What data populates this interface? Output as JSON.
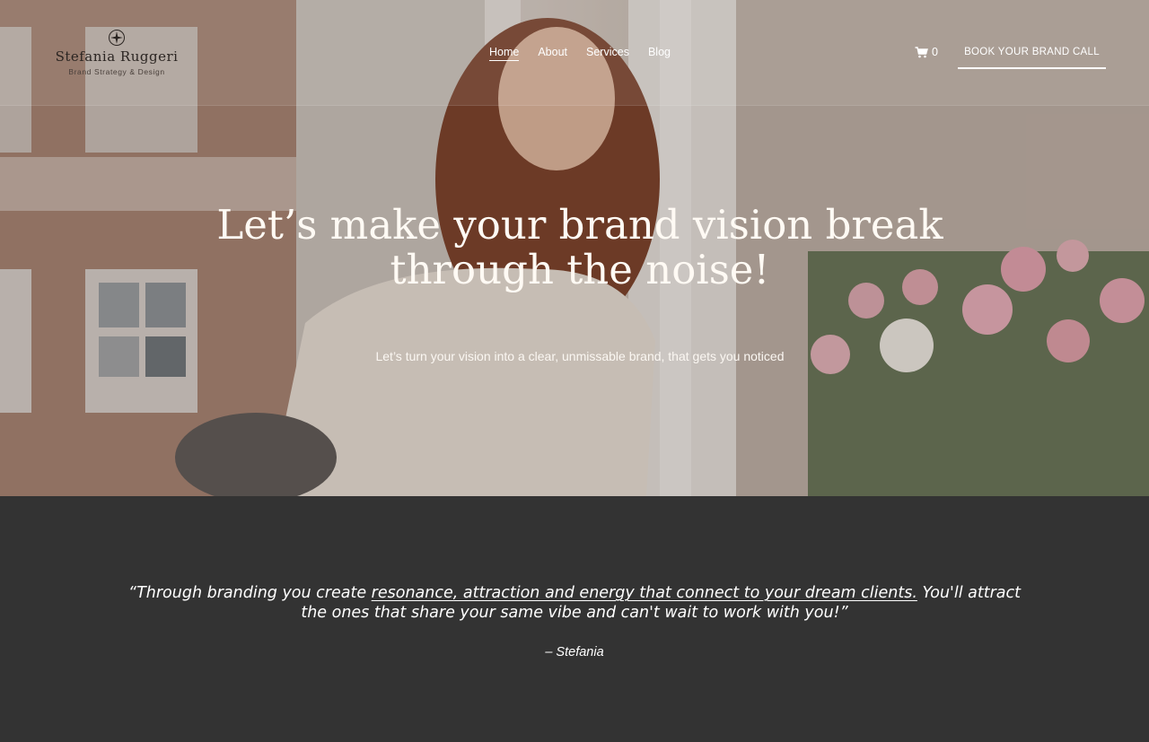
{
  "brand": {
    "name": "Stefania Ruggeri",
    "tagline": "Brand Strategy & Design",
    "logo_icon": "compass-rose-icon"
  },
  "nav": {
    "items": [
      {
        "label": "Home",
        "active": true
      },
      {
        "label": "About",
        "active": false
      },
      {
        "label": "Services",
        "active": false
      },
      {
        "label": "Blog",
        "active": false
      }
    ]
  },
  "cart": {
    "icon": "cart-icon",
    "count": "0"
  },
  "cta": {
    "label": "BOOK YOUR BRAND CALL"
  },
  "hero": {
    "title_line1": "Let’s make your brand vision break",
    "title_line2": "through the noise!",
    "subtitle": "Let’s turn your vision into a clear, unmissable brand, that gets you noticed"
  },
  "quote": {
    "before": "“Through branding you create ",
    "highlight": "resonance, attraction and energy that connect to your dream clients.",
    "after": " You'll attract the ones that share your same vibe and can't wait to work with you!”",
    "author": "– Stefania"
  },
  "colors": {
    "dark_section": "#333333",
    "text_light": "#ffffff",
    "logo_text": "#2b2522"
  }
}
